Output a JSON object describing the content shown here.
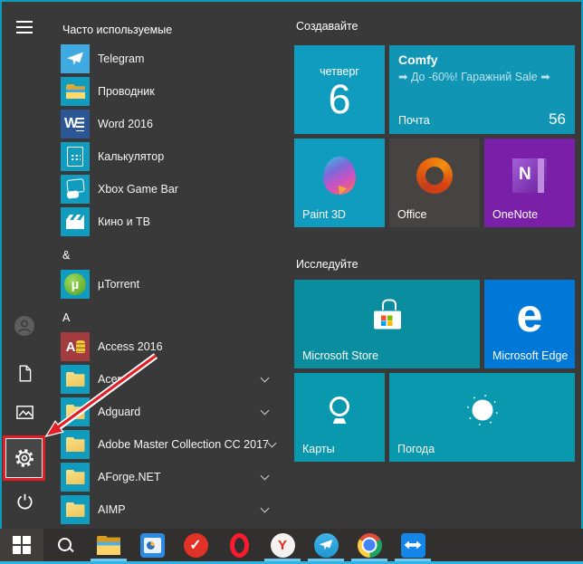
{
  "colors": {
    "accent_border": "#0e9cba",
    "menu_bg": "#393939",
    "taskbar_bg": "#32302e",
    "highlight_red": "#e11d26",
    "running_indicator": "#6cc6ef",
    "cyan_tile": "#0f9cbe"
  },
  "sidebar": {
    "items": [
      {
        "name": "hamburger-menu",
        "icon": "hamburger-icon"
      },
      {
        "name": "user-account",
        "icon": "user-icon"
      },
      {
        "name": "documents",
        "icon": "documents-icon"
      },
      {
        "name": "pictures",
        "icon": "pictures-icon"
      },
      {
        "name": "settings",
        "icon": "gear-icon",
        "highlighted": true
      },
      {
        "name": "power",
        "icon": "power-icon"
      }
    ]
  },
  "app_list": {
    "items": [
      {
        "type": "section",
        "label": "Часто используемые"
      },
      {
        "type": "app",
        "label": "Telegram",
        "icon": "telegram",
        "icon_name": "telegram-app-icon"
      },
      {
        "type": "app",
        "label": "Проводник",
        "icon": "explorer",
        "icon_name": "file-explorer-app-icon"
      },
      {
        "type": "app",
        "label": "Word 2016",
        "icon": "word",
        "icon_name": "word-app-icon"
      },
      {
        "type": "app",
        "label": "Калькулятор",
        "icon": "calculator",
        "icon_name": "calculator-app-icon"
      },
      {
        "type": "app",
        "label": "Xbox Game Bar",
        "icon": "xbox",
        "icon_name": "xbox-game-bar-app-icon"
      },
      {
        "type": "app",
        "label": "Кино и ТВ",
        "icon": "movies",
        "icon_name": "movies-tv-app-icon"
      },
      {
        "type": "section",
        "label": "&"
      },
      {
        "type": "app",
        "label": "µTorrent",
        "icon": "utorrent",
        "icon_name": "utorrent-app-icon"
      },
      {
        "type": "section",
        "label": "A"
      },
      {
        "type": "app",
        "label": "Access 2016",
        "icon": "access",
        "icon_name": "access-app-icon"
      },
      {
        "type": "app",
        "label": "Acer",
        "icon": "folder",
        "icon_name": "folder-icon",
        "chevron": true
      },
      {
        "type": "app",
        "label": "Adguard",
        "icon": "folder",
        "icon_name": "folder-icon",
        "chevron": true
      },
      {
        "type": "app",
        "label": "Adobe Master Collection CC 2017",
        "icon": "folder",
        "icon_name": "folder-icon",
        "chevron": true
      },
      {
        "type": "app",
        "label": "AForge.NET",
        "icon": "folder",
        "icon_name": "folder-icon",
        "chevron": true
      },
      {
        "type": "app",
        "label": "AIMP",
        "icon": "folder",
        "icon_name": "folder-icon",
        "chevron": true
      }
    ]
  },
  "tiles": {
    "create": {
      "header": "Создавайте",
      "calendar": {
        "weekday": "четверг",
        "day": "6",
        "color": "#0f9cbe"
      },
      "mail": {
        "app_name": "Comfy",
        "preview": "➡ До -60%! Гаражний Sale ➡",
        "label": "Почта",
        "unread_count": "56",
        "color": "#1095b4"
      },
      "items": [
        {
          "label": "Paint 3D",
          "icon": "paint3d",
          "icon_name": "paint-3d-icon",
          "color": "#0f9cbe"
        },
        {
          "label": "Office",
          "icon": "office",
          "icon_name": "office-icon",
          "color": "#464340"
        },
        {
          "label": "OneNote",
          "icon": "onenote",
          "icon_name": "onenote-icon",
          "color": "#7a1fa8"
        }
      ]
    },
    "explore": {
      "header": "Исследуйте",
      "items": [
        {
          "label": "Microsoft Store",
          "icon": "store",
          "icon_name": "microsoft-store-icon",
          "color": "#0a8d9f",
          "wide": true
        },
        {
          "label": "Microsoft Edge",
          "icon": "edge",
          "icon_name": "edge-icon",
          "color": "#0078d7"
        },
        {
          "label": "Карты",
          "icon": "maps",
          "icon_name": "maps-pin-icon",
          "color": "#0a98ae"
        },
        {
          "label": "Погода",
          "icon": "weather",
          "icon_name": "weather-sun-icon",
          "color": "#0a98ae",
          "wide": true
        }
      ]
    }
  },
  "taskbar": {
    "items": [
      {
        "name": "start-button",
        "icon": "windows-logo",
        "icon_name": "windows-logo-icon",
        "pressed": true
      },
      {
        "name": "search-button",
        "icon": "search",
        "icon_name": "search-icon"
      },
      {
        "name": "file-explorer-button",
        "icon": "file-explorer",
        "icon_name": "file-explorer-icon",
        "running": true
      },
      {
        "name": "report-app-button",
        "icon": "report-app",
        "icon_name": "report-app-icon"
      },
      {
        "name": "checkmark-app-button",
        "icon": "checkmark-app",
        "icon_name": "checkmark-icon"
      },
      {
        "name": "opera-button",
        "icon": "opera",
        "icon_name": "opera-icon"
      },
      {
        "name": "yandex-browser-button",
        "icon": "yandex-browser",
        "icon_name": "yandex-icon",
        "running": true
      },
      {
        "name": "telegram-button",
        "icon": "telegram-circle",
        "icon_name": "telegram-icon",
        "running": true
      },
      {
        "name": "chrome-button",
        "icon": "chrome",
        "icon_name": "chrome-icon",
        "running": true
      },
      {
        "name": "teamviewer-button",
        "icon": "teamviewer",
        "icon_name": "teamviewer-icon",
        "running": true
      }
    ]
  },
  "annotation": {
    "arrow_color": "#e11d26",
    "highlight_box_color": "#e11d26"
  }
}
